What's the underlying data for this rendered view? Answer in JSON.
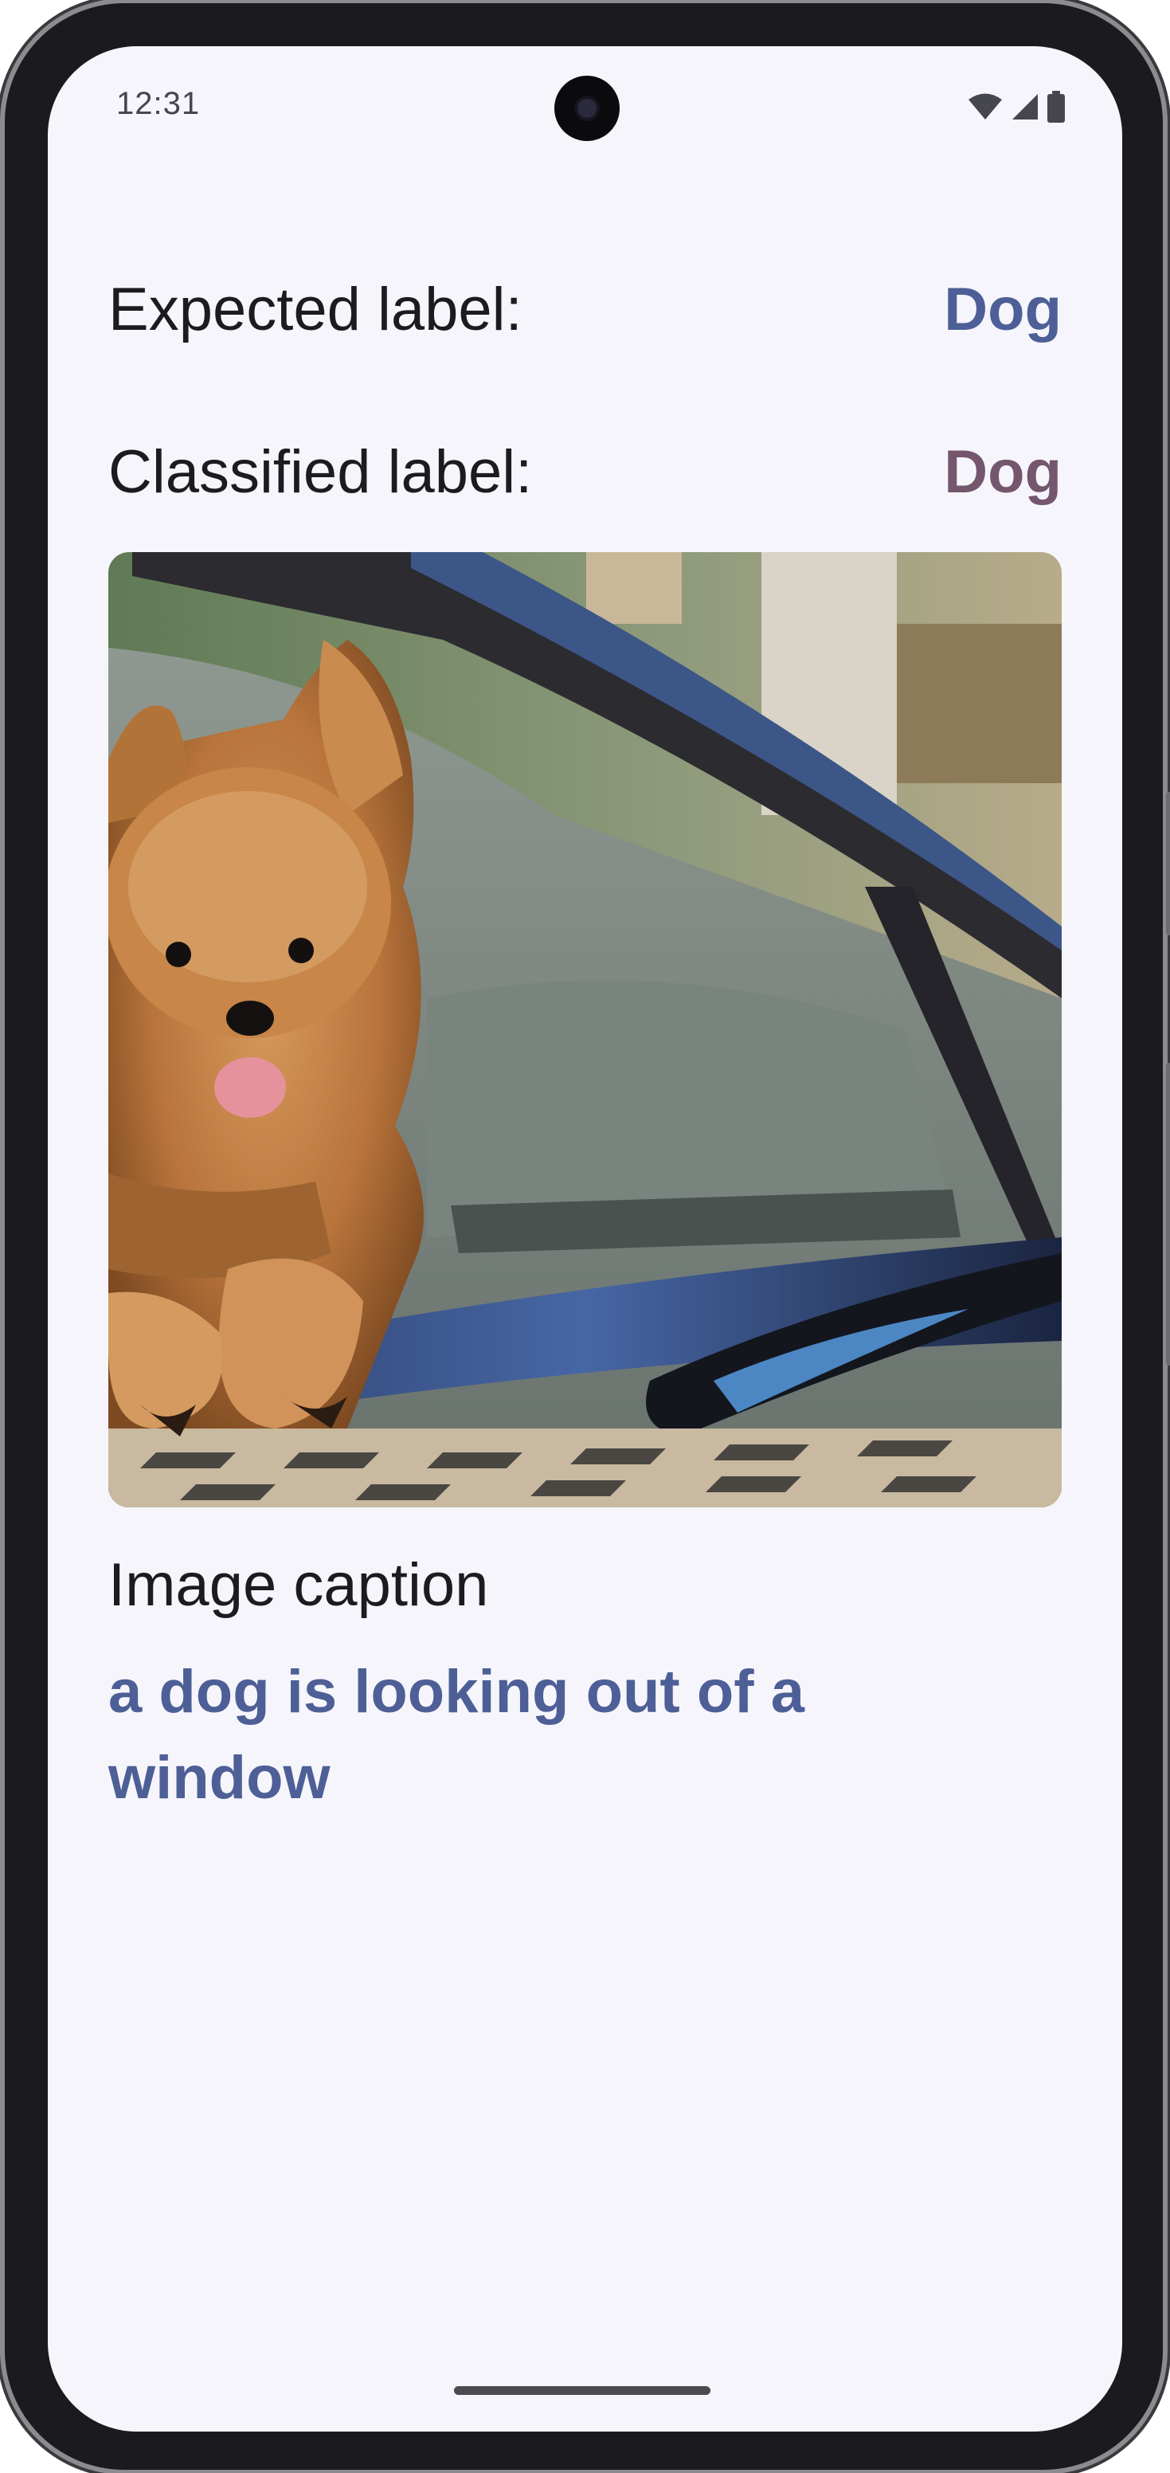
{
  "status_bar": {
    "time": "12:31",
    "icons": [
      "wifi-icon",
      "cellular-signal-icon",
      "battery-icon"
    ]
  },
  "expected": {
    "title": "Expected label:",
    "value": "Dog",
    "color": "#4d5f96"
  },
  "classified": {
    "title": "Classified label:",
    "value": "Dog",
    "color": "#74566d"
  },
  "image": {
    "subject": "dog-looking-out-of-car-window"
  },
  "caption": {
    "title": "Image caption",
    "text": "a dog is looking out of a window"
  }
}
